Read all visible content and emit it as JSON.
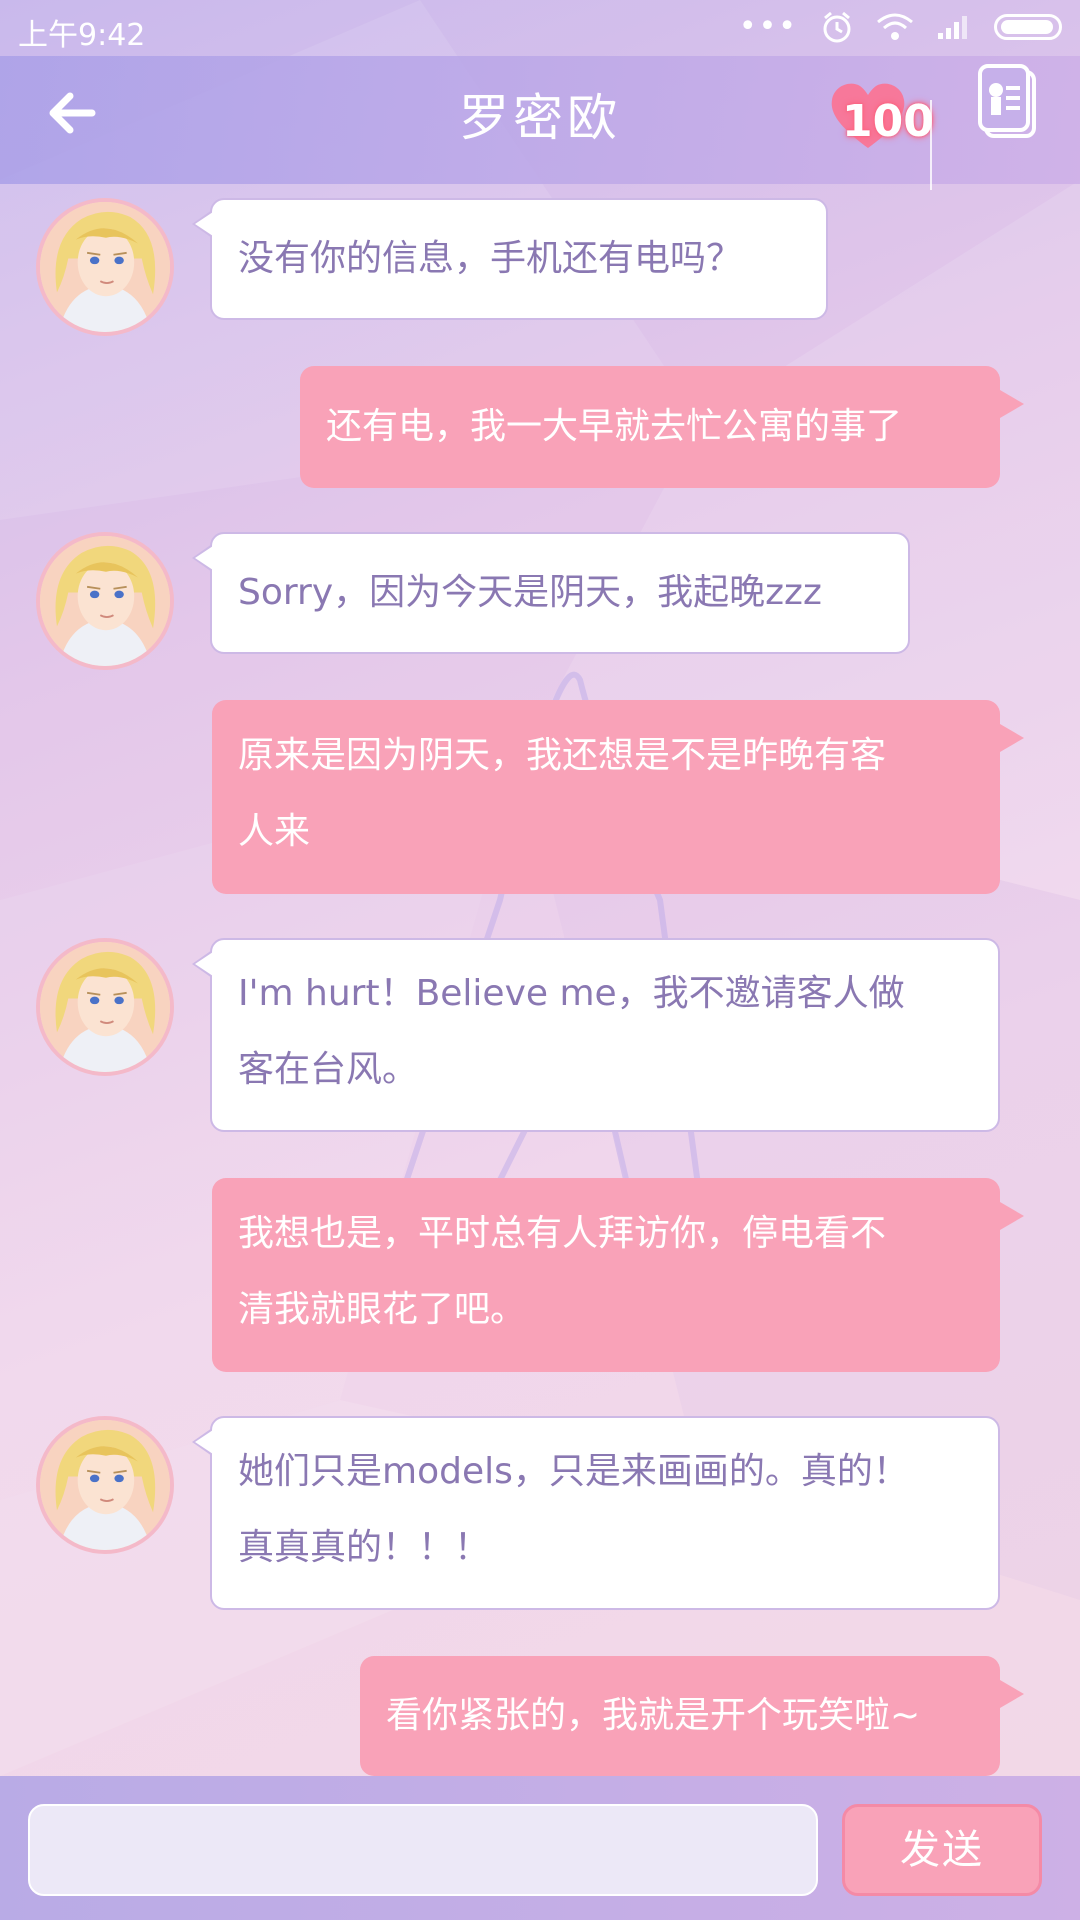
{
  "status_bar": {
    "time": "上午9:42",
    "dots": "•••"
  },
  "header": {
    "back_icon": "arrow-left-icon",
    "title": "罗密欧",
    "affection_value": "100",
    "affection_icon": "heart-icon",
    "profile_icon": "contact-card-icon"
  },
  "messages": [
    {
      "side": "in",
      "text": "没有你的信息，手机还有电吗？"
    },
    {
      "side": "out",
      "text": "还有电，我一大早就去忙公寓的事了"
    },
    {
      "side": "in",
      "text": "Sorry，因为今天是阴天，我起晚zzz"
    },
    {
      "side": "out",
      "lines": [
        "原来是因为阴天，我还想是不是昨晚有客",
        "人来"
      ]
    },
    {
      "side": "in",
      "lines": [
        "I'm hurt！Believe me，我不邀请客人做",
        "客在台风。"
      ]
    },
    {
      "side": "out",
      "lines": [
        "我想也是，平时总有人拜访你，停电看不",
        "清我就眼花了吧。"
      ]
    },
    {
      "side": "in",
      "lines": [
        "她们只是models，只是来画画的。真的！",
        "真真真的！！！"
      ]
    },
    {
      "side": "out",
      "text": "看你紧张的，我就是开个玩笑啦~"
    }
  ],
  "input": {
    "value": "",
    "placeholder": "",
    "send_label": "发送"
  },
  "colors": {
    "incoming_bubble": "#ffffff",
    "incoming_text": "#8a78b2",
    "outgoing_bubble": "#f9a2b8",
    "outgoing_text": "#ffffff",
    "header": "#b8a8e6"
  }
}
